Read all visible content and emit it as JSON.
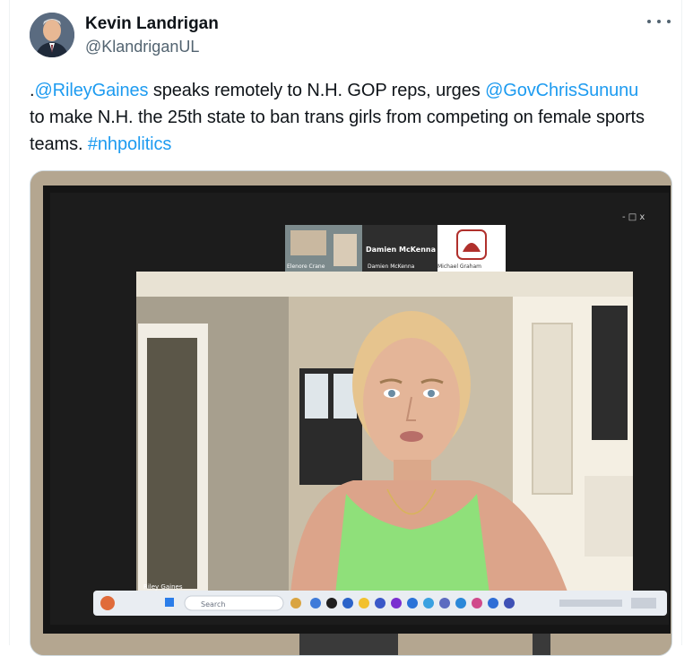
{
  "author": {
    "display_name": "Kevin Landrigan",
    "handle": "@KlandriganUL"
  },
  "menu_icon": "more-horizontal-icon",
  "tweet": {
    "mention_1": "@RileyGaines",
    "text_1": " speaks remotely to N.H. GOP reps, urges ",
    "mention_2": "@GovChrisSununu",
    "text_2": " to make N.H. the 25th state to ban trans girls from competing on female sports teams. ",
    "hashtag": "#nhpolitics"
  },
  "media": {
    "tiles": [
      {
        "name": "Elenore Crane"
      },
      {
        "name": "Damien McKenna"
      },
      {
        "name": "Michael Graham"
      }
    ],
    "speaker_tile_title": "Damien McKenna",
    "main_speaker_label": "Riley Gaines",
    "search_placeholder": "Search",
    "window_controls": "- □ x",
    "colors": {
      "link": "#1d9bf0",
      "top_color": "#8fe07a"
    }
  }
}
